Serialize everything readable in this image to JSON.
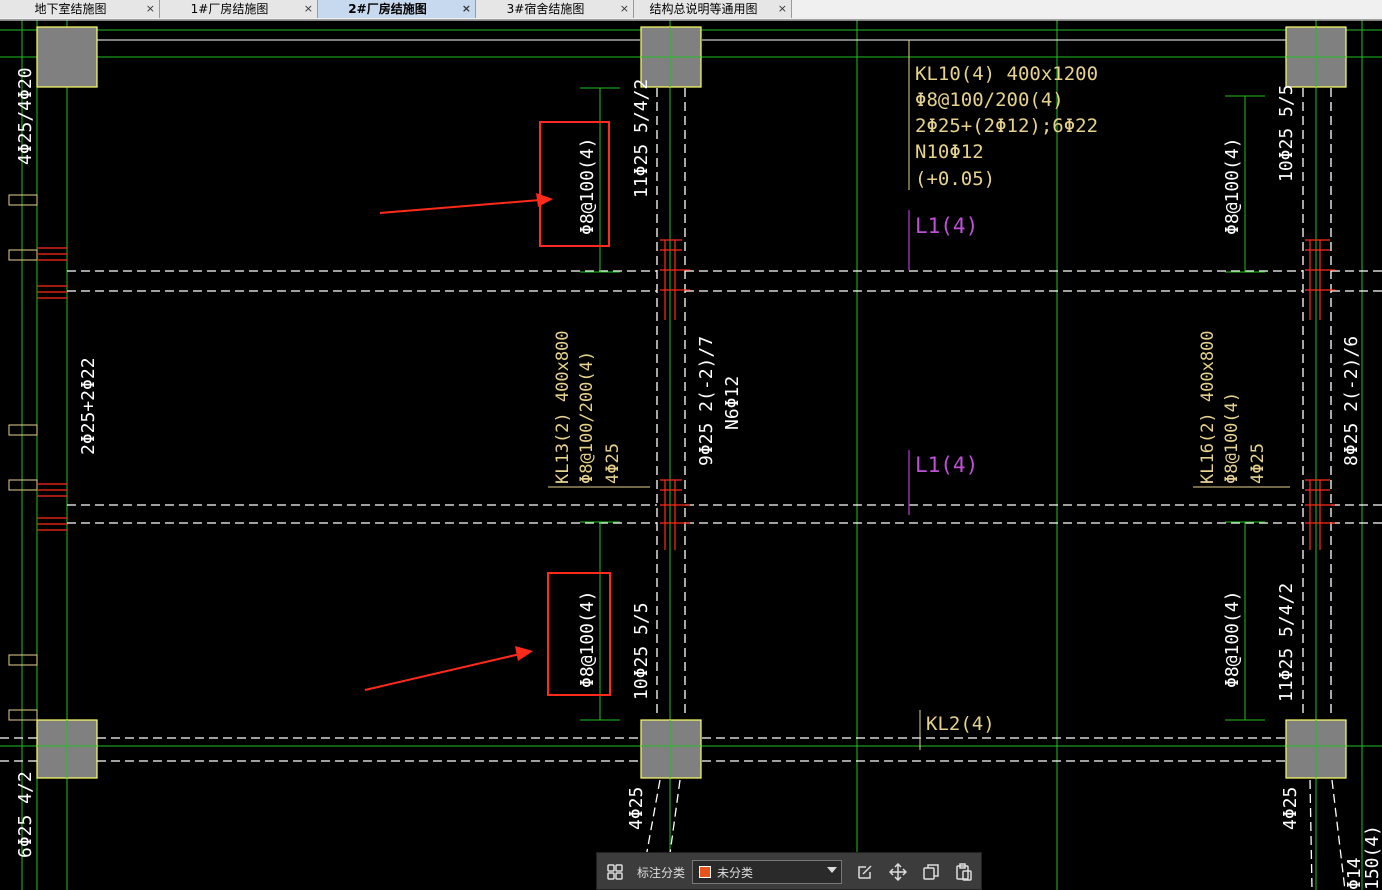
{
  "tabs": [
    {
      "label": "地下室结施图",
      "close": "×"
    },
    {
      "label": "1#厂房结施图",
      "close": "×"
    },
    {
      "label": "2#厂房结施图",
      "close": "×"
    },
    {
      "label": "3#宿舍结施图",
      "close": "×"
    },
    {
      "label": "结构总说明等通用图",
      "close": "×"
    }
  ],
  "active_tab": 2,
  "drawing": {
    "kl10": [
      "KL10(4) 400x1200",
      "Φ8@100/200(4)",
      "2Φ25+(2Φ12);6Φ22",
      "N10Φ12",
      "(+0.05)"
    ],
    "l1_top": "L1(4)",
    "l1_mid": "L1(4)",
    "kl2": "KL2(4)",
    "kl13": [
      "KL13(2) 400x800",
      "Φ8@100/200(4)",
      "4Φ25"
    ],
    "kl16": [
      "KL16(2) 400x800",
      "Φ8@100(4)",
      "4Φ25"
    ],
    "stirrup_tl": "Φ8@100(4)",
    "stirrup_bl": "Φ8@100(4)",
    "stirrup_tr": "Φ8@100(4)",
    "stirrup_br": "Φ8@100(4)",
    "rebar_tl": "11Φ25 5/4/2",
    "rebar_bl": "10Φ25 5/5",
    "rebar_tr": "10Φ25 5/5",
    "rebar_br": "11Φ25 5/4/2",
    "mid_left_1": "9Φ25 2(-2)/7",
    "mid_left_2": "N6Φ12",
    "mid_right": "8Φ25 2(-2)/6",
    "left_top": "4Φ25/4Φ20",
    "left_mid": "2Φ25+2Φ22",
    "left_bot": "6Φ25 4/2",
    "bot_c1": "4Φ25",
    "bot_c2": "4Φ25",
    "edge_right": "Φ14",
    "edge_right2": "150(4)"
  },
  "toolbar": {
    "label": "标注分类",
    "selected": "未分类",
    "swatch_color": "#e8541a"
  },
  "colors": {
    "background": "#000000",
    "column_fill": "#808080",
    "column_edge": "#ffff66",
    "axis_green": "#22c022",
    "beam_text": "#e6d28c",
    "magenta": "#b040d0",
    "red": "#ff2a1a",
    "white": "#ffffff"
  }
}
